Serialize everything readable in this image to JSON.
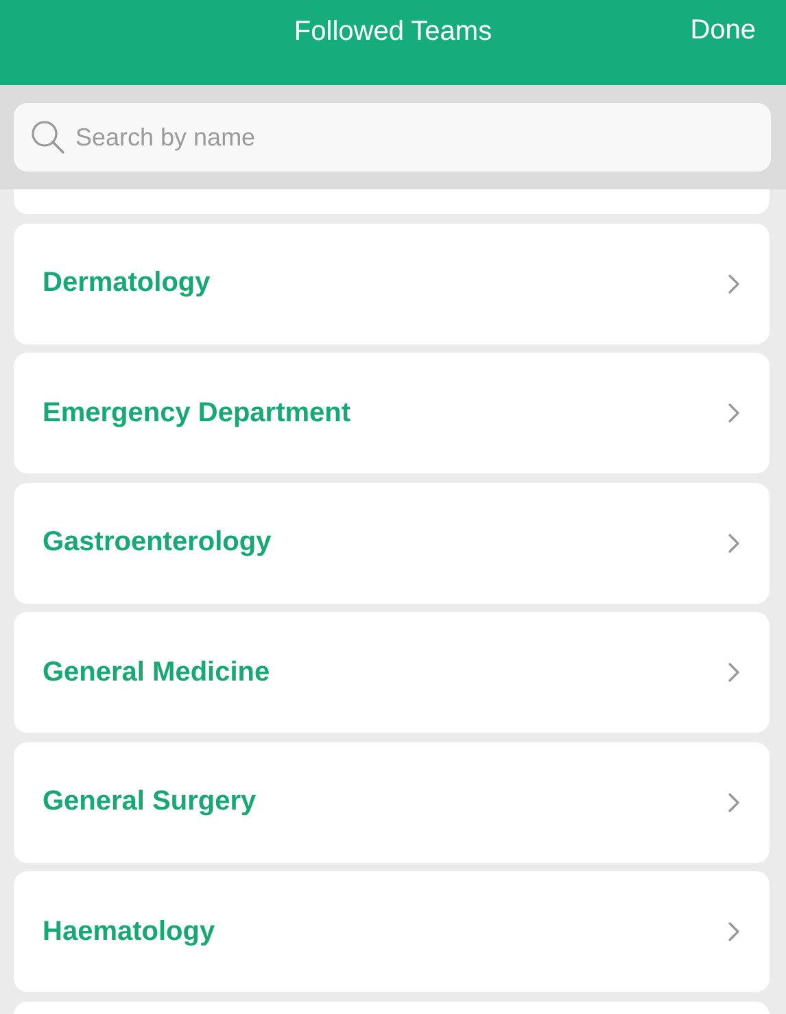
{
  "header": {
    "title": "Followed Teams",
    "done_button": "Done"
  },
  "search": {
    "placeholder": "Search by name"
  },
  "teams": [
    {
      "name": "Dermatology"
    },
    {
      "name": "Emergency Department"
    },
    {
      "name": "Gastroenterology"
    },
    {
      "name": "General Medicine"
    },
    {
      "name": "General Surgery"
    },
    {
      "name": "Haematology"
    }
  ]
}
